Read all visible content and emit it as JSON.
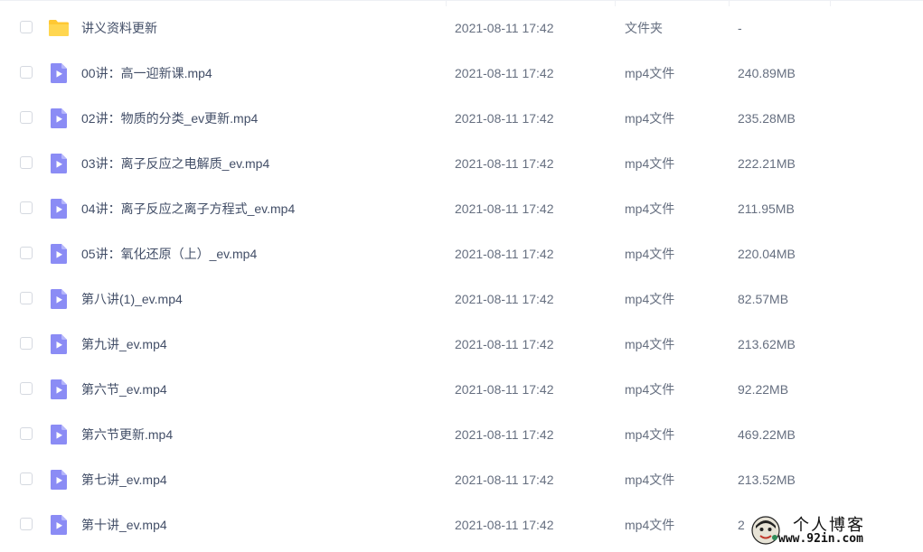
{
  "colors": {
    "folder": "#ffc833",
    "video": "#8b8cf5",
    "text_primary": "#424e67",
    "text_secondary": "#666f80"
  },
  "files": [
    {
      "name": "讲义资料更新",
      "date": "2021-08-11 17:42",
      "type": "文件夹",
      "size": "-",
      "icon": "folder-icon"
    },
    {
      "name": "00讲：高一迎新课.mp4",
      "date": "2021-08-11 17:42",
      "type": "mp4文件",
      "size": "240.89MB",
      "icon": "video-file-icon"
    },
    {
      "name": "02讲：物质的分类_ev更新.mp4",
      "date": "2021-08-11 17:42",
      "type": "mp4文件",
      "size": "235.28MB",
      "icon": "video-file-icon"
    },
    {
      "name": "03讲：离子反应之电解质_ev.mp4",
      "date": "2021-08-11 17:42",
      "type": "mp4文件",
      "size": "222.21MB",
      "icon": "video-file-icon"
    },
    {
      "name": "04讲：离子反应之离子方程式_ev.mp4",
      "date": "2021-08-11 17:42",
      "type": "mp4文件",
      "size": "211.95MB",
      "icon": "video-file-icon"
    },
    {
      "name": "05讲：氧化还原（上）_ev.mp4",
      "date": "2021-08-11 17:42",
      "type": "mp4文件",
      "size": "220.04MB",
      "icon": "video-file-icon"
    },
    {
      "name": "第八讲(1)_ev.mp4",
      "date": "2021-08-11 17:42",
      "type": "mp4文件",
      "size": "82.57MB",
      "icon": "video-file-icon"
    },
    {
      "name": "第九讲_ev.mp4",
      "date": "2021-08-11 17:42",
      "type": "mp4文件",
      "size": "213.62MB",
      "icon": "video-file-icon"
    },
    {
      "name": "第六节_ev.mp4",
      "date": "2021-08-11 17:42",
      "type": "mp4文件",
      "size": "92.22MB",
      "icon": "video-file-icon"
    },
    {
      "name": "第六节更新.mp4",
      "date": "2021-08-11 17:42",
      "type": "mp4文件",
      "size": "469.22MB",
      "icon": "video-file-icon"
    },
    {
      "name": "第七讲_ev.mp4",
      "date": "2021-08-11 17:42",
      "type": "mp4文件",
      "size": "213.52MB",
      "icon": "video-file-icon"
    },
    {
      "name": "第十讲_ev.mp4",
      "date": "2021-08-11 17:42",
      "type": "mp4文件",
      "size": "2",
      "icon": "video-file-icon"
    }
  ],
  "watermark": {
    "title": "个人博客",
    "url": "www.92in.com",
    "icon": "avatar-logo-icon"
  }
}
